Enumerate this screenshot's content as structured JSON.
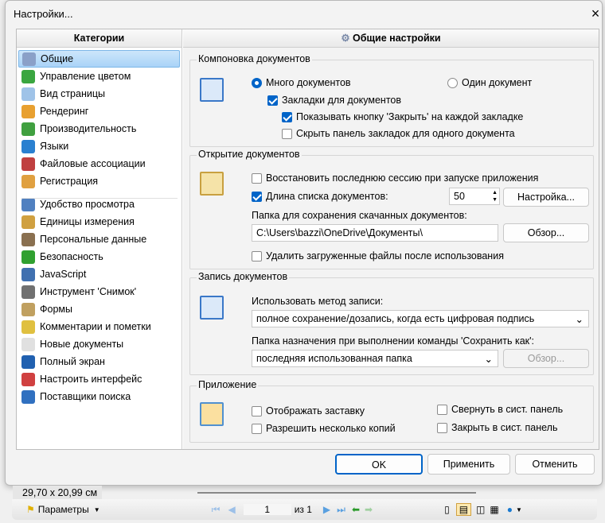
{
  "dialog": {
    "title": "Настройки...",
    "close_icon": "×"
  },
  "left": {
    "header": "Категории",
    "items": [
      {
        "label": "Общие",
        "color": "#8aa0c8"
      },
      {
        "label": "Управление цветом",
        "color": "#3aa640"
      },
      {
        "label": "Вид страницы",
        "color": "#9fc3e8"
      },
      {
        "label": "Рендеринг",
        "color": "#e8a030"
      },
      {
        "label": "Производительность",
        "color": "#40a040"
      },
      {
        "label": "Языки",
        "color": "#2a80d0"
      },
      {
        "label": "Файловые ассоциации",
        "color": "#c04040"
      },
      {
        "label": "Регистрация",
        "color": "#e0a040"
      },
      {
        "label": "Удобство просмотра",
        "color": "#5080c0"
      },
      {
        "label": "Единицы измерения",
        "color": "#d0a040"
      },
      {
        "label": "Персональные данные",
        "color": "#8a7050"
      },
      {
        "label": "Безопасность",
        "color": "#30a030"
      },
      {
        "label": "JavaScript",
        "color": "#4070b0"
      },
      {
        "label": "Инструмент 'Снимок'",
        "color": "#707070"
      },
      {
        "label": "Формы",
        "color": "#c0a060"
      },
      {
        "label": "Комментарии и пометки",
        "color": "#e0c040"
      },
      {
        "label": "Новые документы",
        "color": "#e0e0e0"
      },
      {
        "label": "Полный экран",
        "color": "#2060b0"
      },
      {
        "label": "Настроить интерфейс",
        "color": "#d04040"
      },
      {
        "label": "Поставщики поиска",
        "color": "#3070c0"
      }
    ]
  },
  "right": {
    "header": "Общие настройки",
    "layout": {
      "title": "Компоновка документов",
      "multi": "Много документов",
      "single": "Один документ",
      "tabs": "Закладки для документов",
      "show_close": "Показывать кнопку 'Закрыть' на каждой закладке",
      "hide_panel": "Скрыть панель закладок для одного документа"
    },
    "opening": {
      "title": "Открытие документов",
      "restore": "Восстановить последнюю сессию при запуске приложения",
      "list_len": "Длина списка документов:",
      "list_value": "50",
      "setup": "Настройка...",
      "folder_label": "Папка для сохранения скачанных документов:",
      "folder_value": "C:\\Users\\bazzi\\OneDrive\\Документы\\",
      "browse": "Обзор...",
      "delete": "Удалить загруженные файлы после использования"
    },
    "saving": {
      "title": "Запись документов",
      "method_label": "Использовать метод записи:",
      "method_value": "полное сохранение/дозапись, когда есть цифровая подпись",
      "dest_label": "Папка назначения при выполнении команды 'Сохранить как':",
      "dest_value": "последняя использованная папка",
      "browse": "Обзор..."
    },
    "app": {
      "title": "Приложение",
      "splash": "Отображать заставку",
      "multi": "Разрешить несколько копий",
      "minimize": "Свернуть в сист. панель",
      "close": "Закрыть в сист. панель"
    }
  },
  "buttons": {
    "ok": "OK",
    "apply": "Применить",
    "cancel": "Отменить"
  },
  "status": {
    "size": "29,70 x 20,99 см",
    "params": "Параметры",
    "page": "1",
    "of": "из 1"
  }
}
